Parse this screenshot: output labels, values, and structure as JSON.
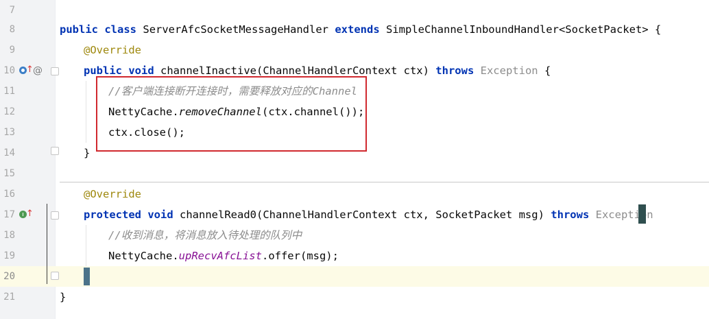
{
  "editor": {
    "lines": [
      {
        "n": "7"
      },
      {
        "n": "8"
      },
      {
        "n": "9"
      },
      {
        "n": "10"
      },
      {
        "n": "11"
      },
      {
        "n": "12"
      },
      {
        "n": "13"
      },
      {
        "n": "14"
      },
      {
        "n": "15"
      },
      {
        "n": "16"
      },
      {
        "n": "17"
      },
      {
        "n": "18"
      },
      {
        "n": "19"
      },
      {
        "n": "20"
      },
      {
        "n": "21"
      }
    ],
    "tokens": {
      "l8_public": "public",
      "l8_class": "class",
      "l8_name": "ServerAfcSocketMessageHandler",
      "l8_extends": "extends",
      "l8_super": "SimpleChannelInboundHandler<SocketPacket> {",
      "l9_ann": "@Override",
      "l10_public": "public",
      "l10_void": "void",
      "l10_sig": "channelInactive(ChannelHandlerContext ctx)",
      "l10_throws": "throws",
      "l10_exc": "Exception",
      "l10_brace": "{",
      "l11_comment": "//客户端连接断开连接时，需要释放对应的Channel",
      "l12_obj": "NettyCache.",
      "l12_method": "removeChannel",
      "l12_args": "(ctx.channel());",
      "l13_code": "ctx.close();",
      "l14_code": "}",
      "l16_ann": "@Override",
      "l17_protected": "protected",
      "l17_void": "void",
      "l17_sig": "channelRead0(ChannelHandlerContext ctx, SocketPacket msg)",
      "l17_throws": "throws",
      "l17_exc": "Exception",
      "l18_comment": "//收到消息，将消息放入待处理的队列中",
      "l19_obj": "NettyCache.",
      "l19_field": "upRecvAfcList",
      "l19_rest": ".offer(msg);",
      "l21_code": "}"
    },
    "gutter_icons": {
      "override_icon": "override-method-icon",
      "implement_icon": "implement-method-icon",
      "at_sign": "@"
    },
    "colors": {
      "keyword": "#0033b3",
      "annotation": "#9e880d",
      "comment": "#8c8c8c",
      "static_field": "#871094",
      "highlight_box": "#d0282e",
      "current_line": "#fdfbe6"
    }
  }
}
